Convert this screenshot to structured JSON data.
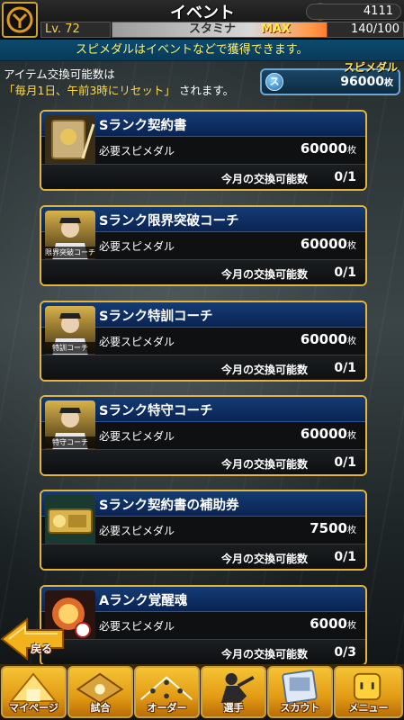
{
  "header": {
    "title": "イベント",
    "level": "Lv. 72",
    "stamina_label": "スタミナ",
    "stamina_max_label": "MAX",
    "stamina_value": "140/100",
    "stamina_fill_fraction": 1.0,
    "coins": "4111"
  },
  "info_bar": {
    "text": "スピメダルはイベントなどで獲得できます。"
  },
  "exchange_note": {
    "line1": "アイテム交換可能数は",
    "line2_highlight": "「毎月1日、午前3時にリセット」",
    "line2_rest": "されます。"
  },
  "medal_panel": {
    "title": "スピメダル",
    "icon_letter": "ス",
    "value": "96000",
    "unit": "枚"
  },
  "items": [
    {
      "name": "Sランク契約書",
      "req_label": "必要スピメダル",
      "req_value": "60000",
      "req_unit": "枚",
      "limit_label": "今月の交換可能数",
      "limit_value": "0/1",
      "thumb_caption": "",
      "thumb_icon": "contract-icon"
    },
    {
      "name": "Sランク限界突破コーチ",
      "req_label": "必要スピメダル",
      "req_value": "60000",
      "req_unit": "枚",
      "limit_label": "今月の交換可能数",
      "limit_value": "0/1",
      "thumb_caption": "限界突破コーチ",
      "thumb_icon": "coach-icon"
    },
    {
      "name": "Sランク特訓コーチ",
      "req_label": "必要スピメダル",
      "req_value": "60000",
      "req_unit": "枚",
      "limit_label": "今月の交換可能数",
      "limit_value": "0/1",
      "thumb_caption": "特訓コーチ",
      "thumb_icon": "coach-icon"
    },
    {
      "name": "Sランク特守コーチ",
      "req_label": "必要スピメダル",
      "req_value": "60000",
      "req_unit": "枚",
      "limit_label": "今月の交換可能数",
      "limit_value": "0/1",
      "thumb_caption": "特守コーチ",
      "thumb_icon": "coach-icon"
    },
    {
      "name": "Sランク契約書の補助券",
      "req_label": "必要スピメダル",
      "req_value": "7500",
      "req_unit": "枚",
      "limit_label": "今月の交換可能数",
      "limit_value": "0/1",
      "thumb_caption": "",
      "thumb_icon": "ticket-icon"
    },
    {
      "name": "Aランク覚醒魂",
      "req_label": "必要スピメダル",
      "req_value": "6000",
      "req_unit": "枚",
      "limit_label": "今月の交換可能数",
      "limit_value": "0/3",
      "thumb_caption": "",
      "thumb_icon": "soul-icon"
    }
  ],
  "back_button": {
    "label": "戻る"
  },
  "nav": [
    {
      "label": "マイページ",
      "icon": "home-icon"
    },
    {
      "label": "試合",
      "icon": "game-icon"
    },
    {
      "label": "オーダー",
      "icon": "order-icon"
    },
    {
      "label": "選手",
      "icon": "player-icon"
    },
    {
      "label": "スカウト",
      "icon": "scout-icon"
    },
    {
      "label": "メニュー",
      "icon": "menu-icon"
    }
  ]
}
